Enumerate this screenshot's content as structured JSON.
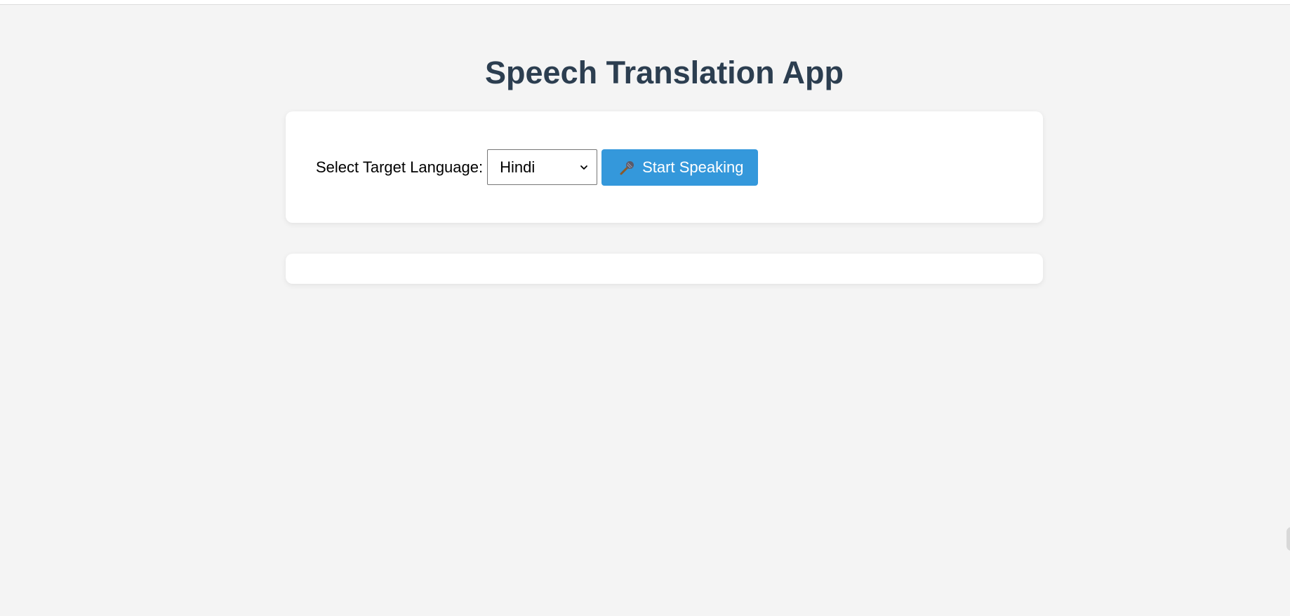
{
  "app": {
    "title": "Speech Translation App"
  },
  "controls": {
    "language_label": "Select Target Language:",
    "language_select": {
      "selected": "Hindi"
    },
    "start_button_label": "Start Speaking",
    "start_button_icon": "microphone-icon"
  },
  "result": {
    "text": ""
  },
  "colors": {
    "background": "#f4f4f4",
    "title": "#2c3e50",
    "accent": "#3498db"
  }
}
